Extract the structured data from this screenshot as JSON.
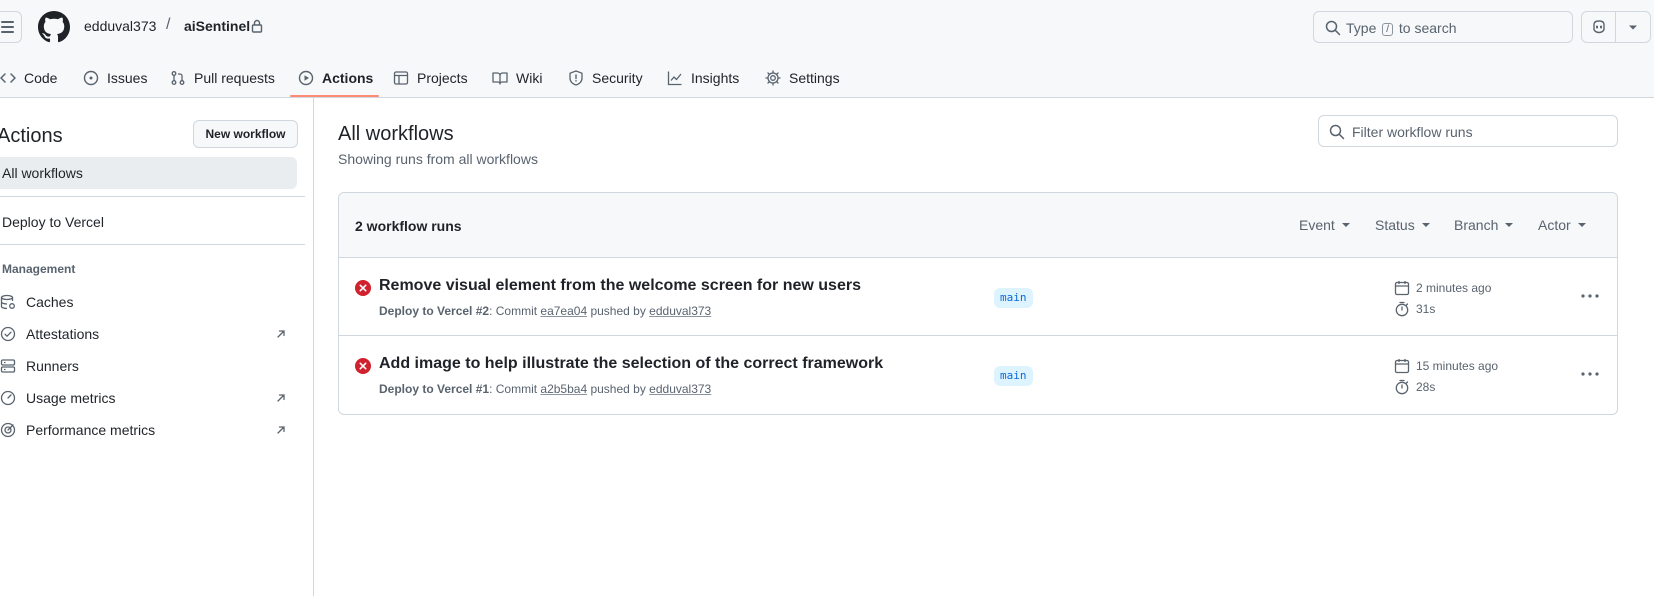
{
  "header": {
    "owner": "edduval373",
    "separator": "/",
    "repo": "aiSentinel",
    "search_prefix": "Type",
    "search_key": "/",
    "search_suffix": "to search"
  },
  "nav": {
    "tabs": [
      {
        "label": "Code",
        "icon": "code-icon"
      },
      {
        "label": "Issues",
        "icon": "issue-opened-icon"
      },
      {
        "label": "Pull requests",
        "icon": "git-pull-request-icon"
      },
      {
        "label": "Actions",
        "icon": "play-icon",
        "active": true
      },
      {
        "label": "Projects",
        "icon": "table-icon"
      },
      {
        "label": "Wiki",
        "icon": "book-icon"
      },
      {
        "label": "Security",
        "icon": "shield-icon"
      },
      {
        "label": "Insights",
        "icon": "graph-icon"
      },
      {
        "label": "Settings",
        "icon": "gear-icon"
      }
    ]
  },
  "sidebar": {
    "title": "Actions",
    "new_workflow_label": "New workflow",
    "all_workflows_label": "All workflows",
    "workflows": [
      "Deploy to Vercel"
    ],
    "management_heading": "Management",
    "management_items": [
      {
        "label": "Caches",
        "icon": "database-icon"
      },
      {
        "label": "Attestations",
        "icon": "verified-icon",
        "external": true
      },
      {
        "label": "Runners",
        "icon": "server-icon"
      },
      {
        "label": "Usage metrics",
        "icon": "meter-icon",
        "external": true
      },
      {
        "label": "Performance metrics",
        "icon": "goal-icon",
        "external": true
      }
    ]
  },
  "main": {
    "title": "All workflows",
    "subtitle": "Showing runs from all workflows",
    "filter_placeholder": "Filter workflow runs",
    "runs_count": "2 workflow runs",
    "filters": [
      "Event",
      "Status",
      "Branch",
      "Actor"
    ],
    "runs": [
      {
        "title": "Remove visual element from the welcome screen for new users",
        "workflow": "Deploy to Vercel #2",
        "commit_prefix": ": Commit ",
        "commit": "ea7ea04",
        "pushed_by_text": " pushed by ",
        "actor": "edduval373",
        "branch": "main",
        "time": "2 minutes ago",
        "duration": "31s",
        "status": "failure"
      },
      {
        "title": "Add image to help illustrate the selection of the correct framework",
        "workflow": "Deploy to Vercel #1",
        "commit_prefix": ": Commit ",
        "commit": "a2b5ba4",
        "pushed_by_text": " pushed by ",
        "actor": "edduval373",
        "branch": "main",
        "time": "15 minutes ago",
        "duration": "28s",
        "status": "failure"
      }
    ]
  },
  "colors": {
    "failure": "#cf222e",
    "tab_underline": "#fd8c73",
    "branch_bg": "#ddf4ff",
    "branch_fg": "#0969da"
  }
}
